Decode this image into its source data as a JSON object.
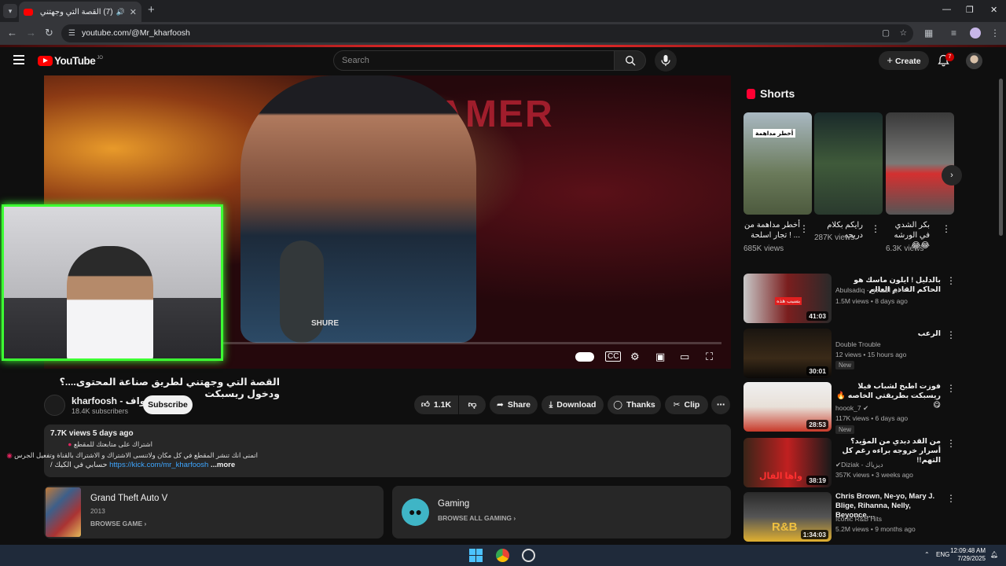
{
  "browser": {
    "tab_title": "(7) القصة التي وجهتني لطري",
    "url": "youtube.com/@Mr_kharfoosh"
  },
  "header": {
    "logo": "YouTube",
    "country_code": "JO",
    "search_placeholder": "Search",
    "create_label": "Create",
    "notifications_count": "7"
  },
  "player": {
    "poster_text": "GAMER",
    "mic_text": "SHURE"
  },
  "video": {
    "title": "القصة التي وجهتني لطريق صناعة المحتوى....؟ ودخول ريسبكت",
    "channel_name": "kharfoosh - نواف",
    "subscribers": "18.4K subscribers",
    "subscribe_label": "Subscribe",
    "likes": "1.1K",
    "share_label": "Share",
    "download_label": "Download",
    "thanks_label": "Thanks",
    "clip_label": "Clip"
  },
  "description": {
    "meta": "7.7K views  5 days ago",
    "line1": "اشتراك على متابعتك للمقطع",
    "line2": "اتمنى انك تنشر المقطع في كل مكان ولاتنسى الاشتراك و الاشتراك بالقناة وتفعيل الجرس",
    "line3_prefix": "حسابي في الكيك /",
    "link": "https://kick.com/mr_kharfoosh",
    "more": "...more"
  },
  "cards": [
    {
      "title": "Grand Theft Auto V",
      "sub": "2013",
      "action": "BROWSE GAME"
    },
    {
      "title": "Gaming",
      "action": "BROWSE ALL GAMING"
    }
  ],
  "shorts": {
    "heading": "Shorts",
    "items": [
      {
        "title": "أخطر مداهمة من ... ! تجار اسلحة",
        "views": "685K views",
        "badge": "أخطر مداهمة"
      },
      {
        "title": "رايكم بكلام دريحه",
        "views": "287K views"
      },
      {
        "title": "بكر الشدي في الورشه 😂😂",
        "views": "6.3K views"
      }
    ]
  },
  "recommended": [
    {
      "title": "بالدليل ! ايلون ماسك هو الحاكم القادم العالم",
      "channel": "Abulsadiq - ابو الصادق",
      "meta": "1.5M views • 8 days ago",
      "duration": "41:03",
      "thumb_text": "بسبب هذه",
      "new": "",
      "rtl": true
    },
    {
      "title": "الرعب",
      "channel": "Double Trouble",
      "meta": "12 views • 15 hours ago",
      "duration": "30:01",
      "new": "New",
      "rtl": true
    },
    {
      "title": "فوزت اطبخ لشباب فيلا ريسبكت بطريقتي الخاصه 🔥 😋",
      "channel": "hoook_7",
      "meta": "117K views • 6 days ago",
      "duration": "28:53",
      "new": "New",
      "rtl": true
    },
    {
      "title": "من القد دبدي من المؤيد؟ أسرار خروجه براءه رغم كل التهم!!",
      "channel": "Diziak - ديزياك",
      "meta": "357K views • 3 weeks ago",
      "duration": "38:19",
      "thumb_text": "واها الفال",
      "new": "",
      "rtl": true
    },
    {
      "title": "Chris Brown, Ne-yo, Mary J. Blige, Rihanna, Nelly, Beyonce,...",
      "channel": "Iconic R&B Hits",
      "meta": "5.2M views • 9 months ago",
      "duration": "1:34:03",
      "thumb_text": "R&B",
      "new": "",
      "rtl": false
    }
  ],
  "taskbar": {
    "lang": "ENG",
    "time": "12:09:48 AM",
    "date": "7/29/2025"
  }
}
